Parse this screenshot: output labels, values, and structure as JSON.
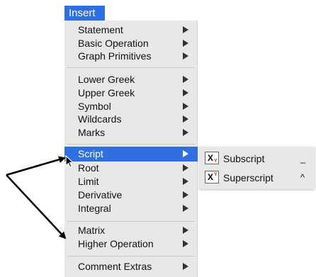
{
  "menubar": {
    "title": "Insert"
  },
  "menu": {
    "groups": [
      [
        "Statement",
        "Basic Operation",
        "Graph Primitives"
      ],
      [
        "Lower Greek",
        "Upper Greek",
        "Symbol",
        "Wildcards",
        "Marks"
      ],
      [
        "Script",
        "Root",
        "Limit",
        "Derivative",
        "Integral"
      ],
      [
        "Matrix",
        "Higher Operation"
      ],
      [
        "Comment Extras"
      ]
    ],
    "highlighted": "Script",
    "highlight_color": "#2f6fe0"
  },
  "submenu": {
    "items": [
      {
        "label": "Subscript",
        "shortcut": "_",
        "icon": "subscript-icon",
        "icon_letters": [
          "X",
          "Y"
        ]
      },
      {
        "label": "Superscript",
        "shortcut": "^",
        "icon": "superscript-icon",
        "icon_letters": [
          "X",
          "Y"
        ]
      }
    ]
  }
}
